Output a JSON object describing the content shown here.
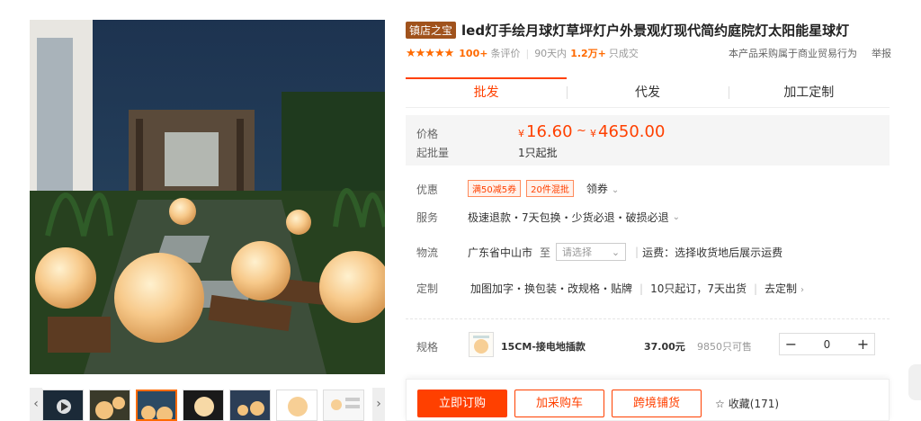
{
  "product": {
    "badge": "镇店之宝",
    "title": "led灯手绘月球灯草坪灯户外景观灯现代简约庭院灯太阳能星球灯"
  },
  "rating": {
    "stars": "★★★★★",
    "review_count": "100+",
    "review_label": "条评价",
    "sales_period": "90天内",
    "sales_count": "1.2万+",
    "sales_label": "只成交",
    "procurement_note": "本产品采购属于商业贸易行为",
    "report_label": "举报"
  },
  "tabs": [
    {
      "label": "批发"
    },
    {
      "label": "代发"
    },
    {
      "label": "加工定制"
    }
  ],
  "price_box": {
    "price_label": "价格",
    "currency": "¥",
    "price_low": "16.60",
    "tilde": "~",
    "price_high": "4650.00",
    "moq_label": "起批量",
    "moq_value": "1只起批"
  },
  "details": {
    "discount_label": "优惠",
    "discount_tags": [
      "满50减5券",
      "20件混批"
    ],
    "coupon_label": "领券",
    "service_label": "服务",
    "service_value": "极速退款・7天包换・少货必退・破损必退",
    "logistics_label": "物流",
    "origin": "广东省中山市",
    "to_label": "至",
    "destination_placeholder": "请选择",
    "freight_text": "运费：选择收货地后展示运费",
    "custom_label": "定制",
    "custom_options": "加图加字・换包装・改规格・贴牌",
    "custom_terms": "10只起订，7天出货",
    "custom_link": "去定制"
  },
  "spec": {
    "label": "规格",
    "name": "15CM-接电地插款",
    "price": "37.00元",
    "stock": "9850只可售",
    "quantity": "0",
    "minus": "−",
    "plus": "+"
  },
  "actions": {
    "buy_now": "立即订购",
    "add_cart": "加采购车",
    "cross_border": "跨境铺货",
    "favorite": "收藏(171)"
  },
  "colors": {
    "accent": "#ff4000",
    "badge_bg": "#a0521c"
  }
}
